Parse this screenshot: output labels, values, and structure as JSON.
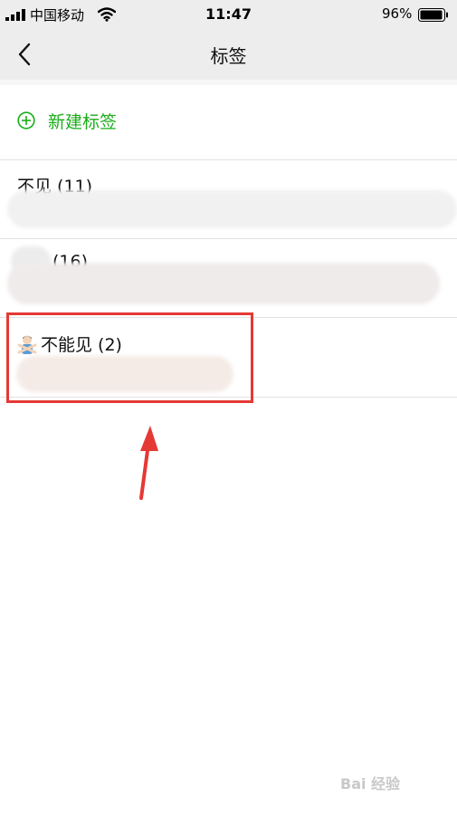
{
  "status_bar": {
    "carrier": "中国移动",
    "time": "11:47",
    "battery_percent": "96%",
    "battery_level": 0.96,
    "signal_icon": "signal-bars-icon",
    "wifi_icon": "wifi-icon",
    "battery_icon": "battery-icon"
  },
  "nav": {
    "title": "标签",
    "back_icon": "chevron-left-icon"
  },
  "new_tag": {
    "label": "新建标签",
    "icon": "plus-circle-icon"
  },
  "tags": [
    {
      "name": "不见 (11)"
    },
    {
      "name": "(16)"
    },
    {
      "name": "不能见 (2)",
      "icon": "person-crossed-arms-emoji"
    }
  ],
  "watermark": {
    "text": "Bai 经验"
  },
  "colors": {
    "accent_green": "#1aad19",
    "annotation_red": "#e53935",
    "nav_background": "#ededed"
  }
}
